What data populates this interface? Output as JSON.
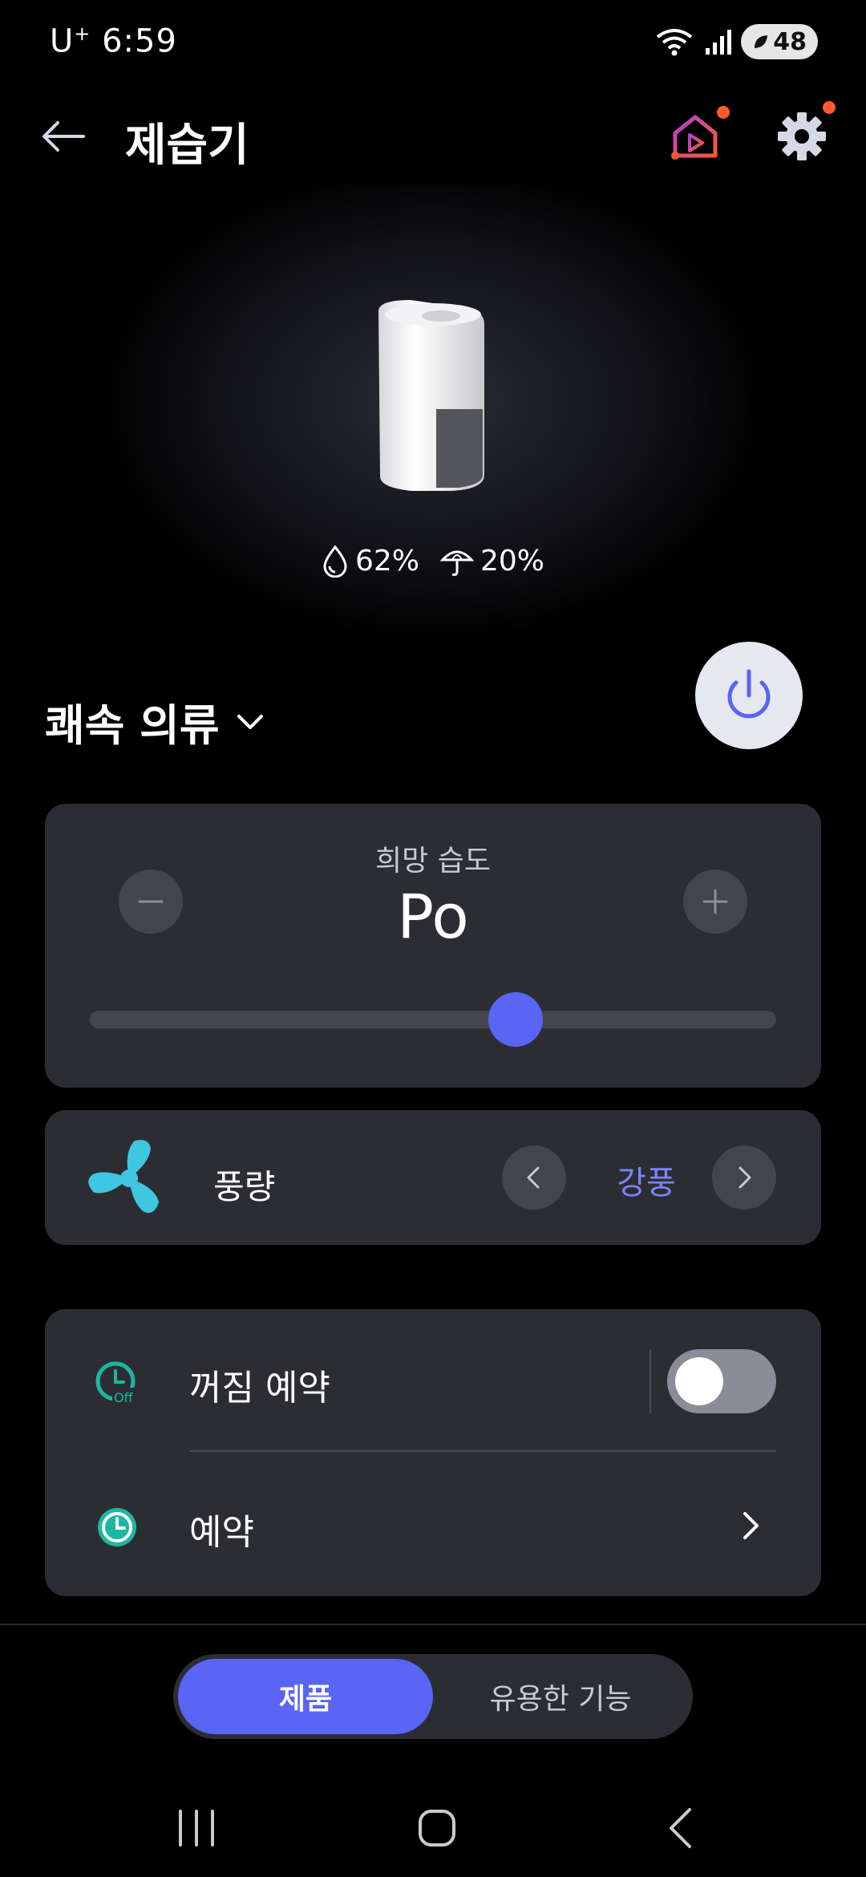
{
  "status_bar": {
    "carrier": "U",
    "carrier_sup": "+",
    "time": "6:59",
    "battery": "48"
  },
  "header": {
    "title": "제습기"
  },
  "hero": {
    "humidity": "62%",
    "water_tank": "20%"
  },
  "mode": {
    "label": "쾌속 의류"
  },
  "humidity_control": {
    "caption": "희망 습도",
    "value": "Po",
    "slider_level_percent": 62
  },
  "fan": {
    "label": "풍량",
    "value": "강풍"
  },
  "schedule": {
    "off_timer_label": "꺼짐 예약",
    "off_timer_enabled": false,
    "reservation_label": "예약"
  },
  "tabs": {
    "product": "제품",
    "useful": "유용한 기능"
  },
  "colors": {
    "accent": "#5a64f5",
    "fan_icon": "#3fc6e0",
    "notification_dot": "#ff5a2c",
    "timer_icon": "#1db7a1"
  }
}
